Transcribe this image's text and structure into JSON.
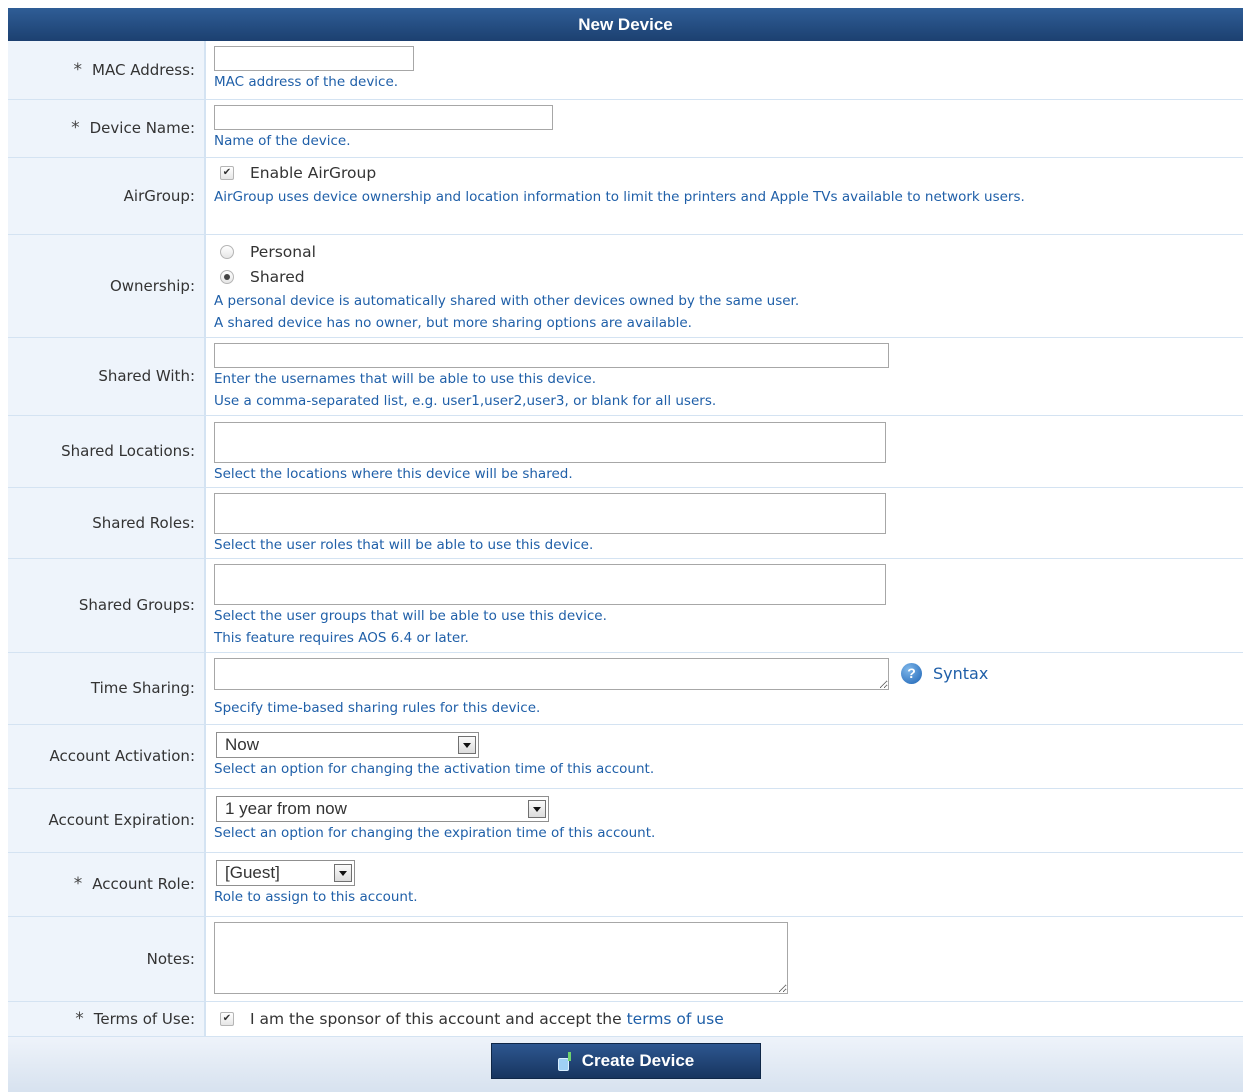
{
  "header": {
    "title": "New Device"
  },
  "mac": {
    "label": "MAC Address:",
    "hint": "MAC address of the device.",
    "value": ""
  },
  "device_name": {
    "label": "Device Name:",
    "hint": "Name of the device.",
    "value": ""
  },
  "airgroup": {
    "label": "AirGroup:",
    "option": "Enable AirGroup",
    "checked": true,
    "hint": "AirGroup uses device ownership and location information to limit the printers and Apple TVs available to network users."
  },
  "ownership": {
    "label": "Ownership:",
    "options": [
      "Personal",
      "Shared"
    ],
    "selected": "Shared",
    "hint1": "A personal device is automatically shared with other devices owned by the same user.",
    "hint2": "A shared device has no owner, but more sharing options are available."
  },
  "shared_with": {
    "label": "Shared With:",
    "hint1": "Enter the usernames that will be able to use this device.",
    "hint2": "Use a comma-separated list, e.g. user1,user2,user3, or blank for all users.",
    "value": ""
  },
  "shared_locations": {
    "label": "Shared Locations:",
    "hint": "Select the locations where this device will be shared."
  },
  "shared_roles": {
    "label": "Shared Roles:",
    "hint": "Select the user roles that will be able to use this device."
  },
  "shared_groups": {
    "label": "Shared Groups:",
    "hint1": "Select the user groups that will be able to use this device.",
    "hint2": "This feature requires AOS 6.4 or later."
  },
  "time_sharing": {
    "label": "Time Sharing:",
    "syntax_link": "Syntax",
    "hint": "Specify time-based sharing rules for this device."
  },
  "activation": {
    "label": "Account Activation:",
    "selected": "Now",
    "hint": "Select an option for changing the activation time of this account."
  },
  "expiration": {
    "label": "Account Expiration:",
    "selected": "1 year from now",
    "hint": "Select an option for changing the expiration time of this account."
  },
  "role": {
    "label": "Account Role:",
    "selected": "[Guest]",
    "hint": "Role to assign to this account."
  },
  "notes": {
    "label": "Notes:",
    "value": ""
  },
  "terms": {
    "label": "Terms of Use:",
    "checked": true,
    "text": "I am the sponsor of this account and accept the",
    "link": "terms of use"
  },
  "required_marker": "*",
  "check_glyph": "✔",
  "help_glyph": "?",
  "submit": {
    "label": "Create Device"
  },
  "colors": {
    "header": "#1f4a80",
    "hint": "#1f5fa8",
    "label_bg": "#eef4fb",
    "border": "#d4e3f2"
  },
  "icons": [
    "help-icon",
    "device-add-icon",
    "dropdown-arrow-icon",
    "resize-grip-icon"
  ]
}
